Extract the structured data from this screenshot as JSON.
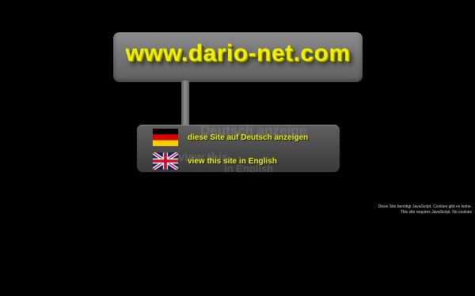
{
  "banner": {
    "logo_text": "www.dario-net.com"
  },
  "languages": {
    "german": {
      "label": "diese Site auf Deutsch anzeigen",
      "flag": "germany-flag"
    },
    "english": {
      "label": "view this site in English",
      "flag": "uk-flag"
    },
    "ghost_texts": [
      "Deutsch anzeige",
      "view this",
      "in English"
    ]
  },
  "notes": {
    "line1": "Diese Site benötigt JavaScript. Cookies gibt es keine.",
    "line2": "This site requires JavaScript. No cookies"
  },
  "colors": {
    "background": "#000000",
    "link": "#f2f200",
    "logo": "#f0f000",
    "panel": "#7a7a7a"
  }
}
